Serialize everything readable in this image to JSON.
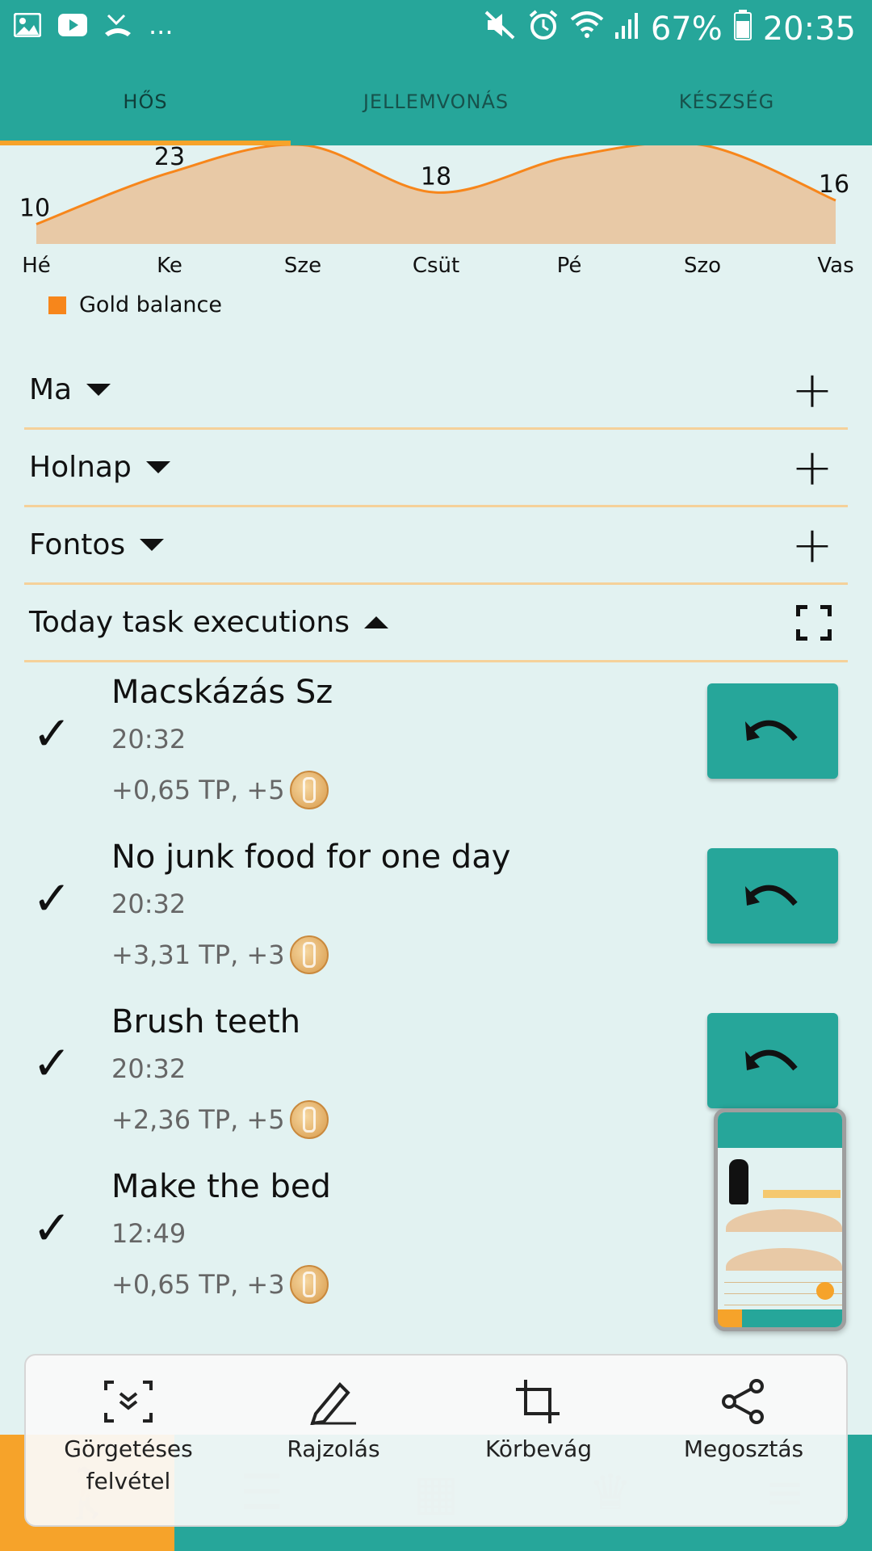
{
  "status_bar": {
    "left_icons": [
      "image-icon",
      "youtube-icon",
      "missed-call-icon"
    ],
    "more": "...",
    "battery": "67%",
    "time": "20:35"
  },
  "tabs": [
    {
      "label": "HŐS",
      "active": true
    },
    {
      "label": "JELLEMVONÁS",
      "active": false
    },
    {
      "label": "KÉSZSÉG",
      "active": false
    }
  ],
  "chart_data": {
    "type": "area",
    "categories": [
      "Hé",
      "Ke",
      "Sze",
      "Csüt",
      "Pé",
      "Szo",
      "Vas"
    ],
    "series": [
      {
        "name": "Gold balance",
        "values": [
          10,
          23,
          30,
          18,
          27,
          30,
          16
        ],
        "color": "#f7861b"
      }
    ],
    "point_labels": [
      "10",
      "23",
      "",
      "18",
      "",
      "",
      "16"
    ],
    "legend_position": "bottom-left"
  },
  "sections": {
    "today": {
      "label": "Ma"
    },
    "tomorrow": {
      "label": "Holnap"
    },
    "important": {
      "label": "Fontos"
    },
    "executions": {
      "label": "Today task executions"
    }
  },
  "tasks": [
    {
      "title": "Macskázás Sz",
      "time": "20:32",
      "reward": "+0,65 TP, +5"
    },
    {
      "title": "No junk food for one day",
      "time": "20:32",
      "reward": "+3,31 TP, +3"
    },
    {
      "title": "Brush teeth",
      "time": "20:32",
      "reward": "+2,36 TP, +5"
    },
    {
      "title": "Make the bed",
      "time": "12:49",
      "reward": "+0,65 TP, +3"
    }
  ],
  "toolbar": {
    "scroll_capture": "Görgetéses felvétel",
    "draw": "Rajzolás",
    "crop": "Körbevág",
    "share": "Megosztás"
  },
  "colors": {
    "primary": "#26a69a",
    "accent": "#f6a32a",
    "chart_line": "#f7861b",
    "chart_fill": "#e8c9a6",
    "background": "#e2f2f1"
  }
}
